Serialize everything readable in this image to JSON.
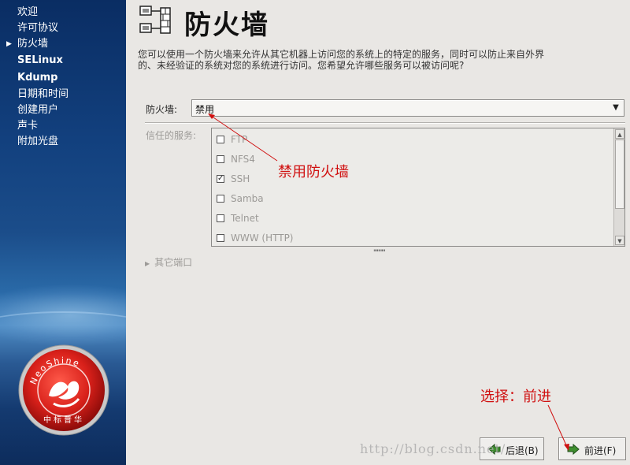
{
  "sidebar": {
    "items": [
      {
        "label": "欢迎",
        "current": false,
        "bold": false
      },
      {
        "label": "许可协议",
        "current": false,
        "bold": false
      },
      {
        "label": "防火墙",
        "current": true,
        "bold": false
      },
      {
        "label": "SELinux",
        "current": false,
        "bold": true
      },
      {
        "label": "Kdump",
        "current": false,
        "bold": true
      },
      {
        "label": "日期和时间",
        "current": false,
        "bold": false
      },
      {
        "label": "创建用户",
        "current": false,
        "bold": false
      },
      {
        "label": "声卡",
        "current": false,
        "bold": false
      },
      {
        "label": "附加光盘",
        "current": false,
        "bold": false
      }
    ],
    "logo": {
      "text_top": "NeoShine",
      "text_bottom": "中标普华",
      "icon": "neoshine-logo"
    }
  },
  "header": {
    "title": "防火墙",
    "icon": "firewall-icon"
  },
  "description": "您可以使用一个防火墙来允许从其它机器上访问您的系统上的特定的服务，同时可以防止来自外界的、未经验证的系统对您的系统进行访问。您希望允许哪些服务可以被访问呢?",
  "firewall": {
    "label": "防火墙:",
    "value": "禁用"
  },
  "trusted_services": {
    "label": "信任的服务:",
    "items": [
      {
        "label": "FTP",
        "checked": false
      },
      {
        "label": "NFS4",
        "checked": false
      },
      {
        "label": "SSH",
        "checked": true
      },
      {
        "label": "Samba",
        "checked": false
      },
      {
        "label": "Telnet",
        "checked": false
      },
      {
        "label": "WWW (HTTP)",
        "checked": false
      }
    ]
  },
  "other_ports": {
    "label": "其它端口"
  },
  "buttons": {
    "back": "后退(B)",
    "next": "前进(F)"
  },
  "annotations": {
    "disable_firewall": "禁用防火墙",
    "select_next": "选择：前进"
  },
  "watermark": "http://blog.csdn.net/",
  "colors": {
    "sidebar": "#12407e",
    "annotation": "#d01010",
    "disabled_text": "#9c9a97"
  }
}
